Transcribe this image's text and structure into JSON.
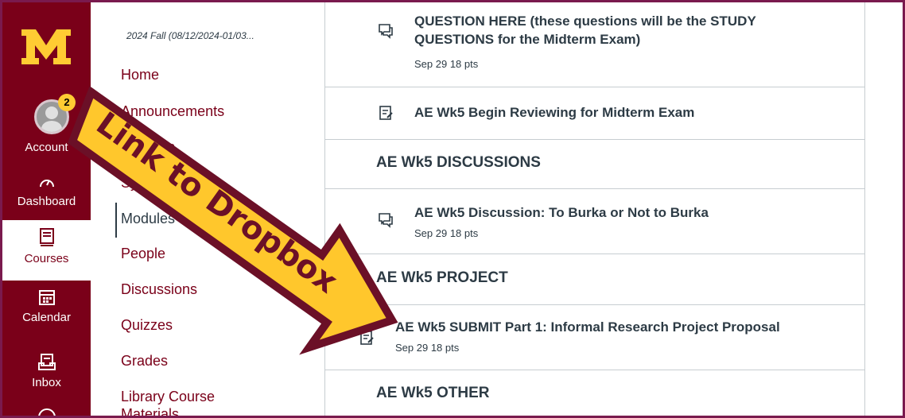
{
  "global_nav": {
    "account_label": "Account",
    "account_badge": "2",
    "dashboard_label": "Dashboard",
    "courses_label": "Courses",
    "calendar_label": "Calendar",
    "inbox_label": "Inbox",
    "brand_color": "#7a0019",
    "logo_color": "#ffcc33"
  },
  "course_nav": {
    "term": "2024 Fall (08/12/2024-01/03...",
    "links": [
      "Home",
      "Announcements",
      "Syllabus",
      "Syllabus",
      "Modules",
      "People",
      "Discussions",
      "Quizzes",
      "Grades",
      "Library Course Materials"
    ]
  },
  "modules": {
    "item_question_title": "QUESTION HERE (these questions will be the STUDY QUESTIONS for the Midterm Exam)",
    "item_question_meta": "Sep 29   18 pts",
    "item_review_title": "AE Wk5 Begin Reviewing for Midterm Exam",
    "header_discussions": "AE Wk5 DISCUSSIONS",
    "item_discussion_title": "AE Wk5 Discussion: To Burka or Not to Burka",
    "item_discussion_meta": "Sep 29   18 pts",
    "header_project": "AE Wk5 PROJECT",
    "item_submit_title": "AE Wk5 SUBMIT Part 1: Informal Research Project Proposal",
    "item_submit_meta": "Sep 29   18 pts",
    "header_other": "AE Wk5 OTHER"
  },
  "annotation": {
    "arrow_text": "Link to Dropbox",
    "arrow_fill": "#ffc72c",
    "arrow_outline": "#6b1027"
  }
}
